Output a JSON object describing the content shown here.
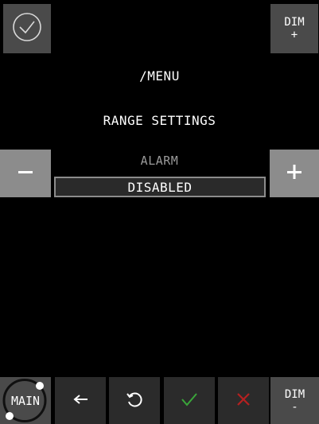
{
  "top_bar": {
    "confirm_icon": "check-circle-icon",
    "dim_up": {
      "line1": "DIM",
      "line2": "+"
    }
  },
  "content": {
    "path": "/MENU",
    "section": "RANGE SETTINGS",
    "field_label": "ALARM",
    "field_value": "DISABLED"
  },
  "side_buttons": {
    "minus_icon": "minus-icon",
    "plus_icon": "plus-icon"
  },
  "bottom_bar": {
    "main_label": "MAIN",
    "back_icon": "arrow-left-icon",
    "reset_icon": "undo-icon",
    "accept_icon": "check-icon",
    "cancel_icon": "close-icon",
    "dim_down": {
      "line1": "DIM",
      "line2": "-"
    }
  },
  "colors": {
    "accept": "#3aa63a",
    "cancel": "#b52020"
  }
}
